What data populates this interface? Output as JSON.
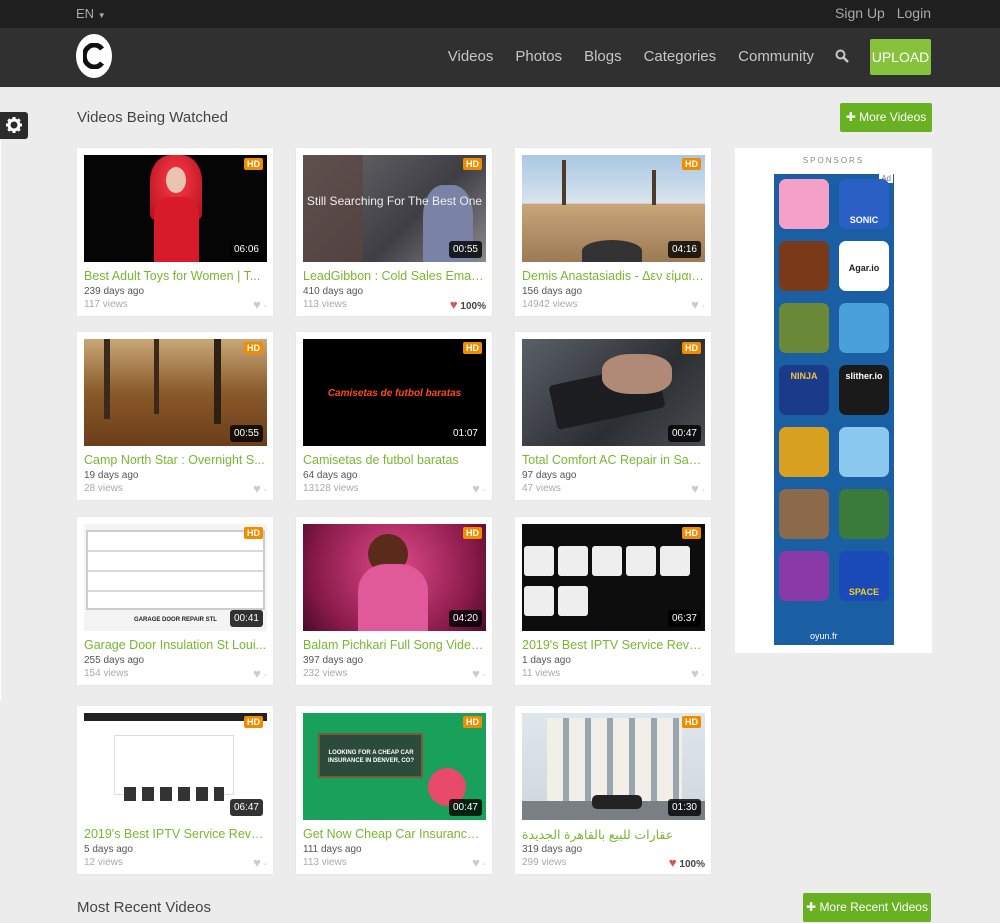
{
  "topbar": {
    "language": "EN",
    "sign_up": "Sign Up",
    "login": "Login"
  },
  "nav": {
    "items": [
      "Videos",
      "Photos",
      "Blogs",
      "Categories",
      "Community"
    ],
    "upload": "UPLOAD"
  },
  "watched": {
    "title": "Videos Being Watched",
    "more": "More Videos"
  },
  "recent": {
    "title": "Most Recent Videos",
    "more": "More Recent Videos"
  },
  "sponsors": {
    "label": "SPONSORS",
    "ad_tag": "Ad",
    "footer": "oyun.fr",
    "games": [
      "",
      "SONIC",
      "",
      "Agar.io",
      "",
      "",
      "NINJA",
      "slither.io",
      "",
      "",
      "",
      "",
      "",
      "SPACE"
    ]
  },
  "videos": [
    {
      "title": "Best Adult Toys for Women | T...",
      "ago": "239 days ago",
      "views": "117 views",
      "like": "-",
      "liked": false,
      "hd": "HD",
      "duration": "06:06",
      "overlay": ""
    },
    {
      "title": "LeadGibbon : Cold Sales Email ...",
      "ago": "410 days ago",
      "views": "113 views",
      "like": "100%",
      "liked": true,
      "hd": "HD",
      "duration": "00:55",
      "overlay": "Still Searching For The Best One"
    },
    {
      "title": "Demis Anastasiadis - Δεν είμαι ...",
      "ago": "156 days ago",
      "views": "14942 views",
      "like": "-",
      "liked": false,
      "hd": "HD",
      "duration": "04:16",
      "overlay": ""
    },
    {
      "title": "Camp North Star : Overnight S...",
      "ago": "19 days ago",
      "views": "28 views",
      "like": "-",
      "liked": false,
      "hd": "HD",
      "duration": "00:55",
      "overlay": ""
    },
    {
      "title": "Camisetas de futbol baratas",
      "ago": "64 days ago",
      "views": "13128 views",
      "like": "-",
      "liked": false,
      "hd": "HD",
      "duration": "01:07",
      "overlay": "Camisetas de futbol baratas"
    },
    {
      "title": "Total Comfort AC Repair in San...",
      "ago": "97 days ago",
      "views": "47 views",
      "like": "-",
      "liked": false,
      "hd": "HD",
      "duration": "00:47",
      "overlay": ""
    },
    {
      "title": "Garage Door Insulation St Loui...",
      "ago": "255 days ago",
      "views": "154 views",
      "like": "-",
      "liked": false,
      "hd": "HD",
      "duration": "00:41",
      "overlay": "GARAGE DOOR REPAIR STL"
    },
    {
      "title": "Balam Pichkari Full Song Video...",
      "ago": "397 days ago",
      "views": "232 views",
      "like": "-",
      "liked": false,
      "hd": "HD",
      "duration": "04:20",
      "overlay": ""
    },
    {
      "title": "2019's Best IPTV Service Reveal...",
      "ago": "1 days ago",
      "views": "11 views",
      "like": "-",
      "liked": false,
      "hd": "HD",
      "duration": "06:37",
      "overlay": ""
    },
    {
      "title": "2019's Best IPTV Service Reveal...",
      "ago": "5 days ago",
      "views": "12 views",
      "like": "-",
      "liked": false,
      "hd": "HD",
      "duration": "06:47",
      "overlay": ""
    },
    {
      "title": "Get Now Cheap Car Insurance ...",
      "ago": "111 days ago",
      "views": "113 views",
      "like": "-",
      "liked": false,
      "hd": "HD",
      "duration": "00:47",
      "overlay": "LOOKING FOR A CHEAP CAR INSURANCE IN DENVER, CO?"
    },
    {
      "title": "عقارات للبيع بالقاهرة الجديدة",
      "ago": "319 days ago",
      "views": "299 views",
      "like": "100%",
      "liked": true,
      "hd": "HD",
      "duration": "01:30",
      "overlay": ""
    }
  ]
}
